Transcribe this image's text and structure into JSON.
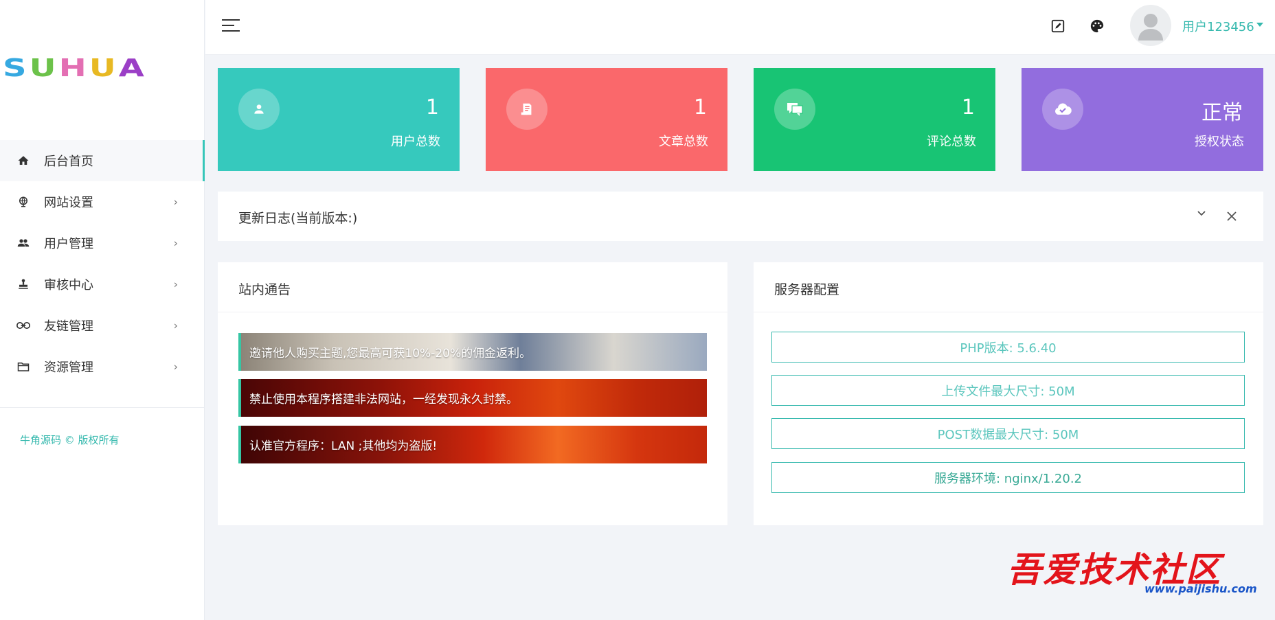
{
  "logo": {
    "letters": [
      {
        "ch": "S",
        "color": "#36a9e1"
      },
      {
        "ch": "U",
        "color": "#6cc24a"
      },
      {
        "ch": "H",
        "color": "#e36fb3"
      },
      {
        "ch": "U",
        "color": "#e8b923"
      },
      {
        "ch": "A",
        "color": "#9b3fc6"
      }
    ]
  },
  "sidebar": {
    "items": [
      {
        "label": "后台首页",
        "icon": "home-icon",
        "active": true
      },
      {
        "label": "网站设置",
        "icon": "globe-icon"
      },
      {
        "label": "用户管理",
        "icon": "users-icon"
      },
      {
        "label": "审核中心",
        "icon": "stamp-icon"
      },
      {
        "label": "友链管理",
        "icon": "link-icon"
      },
      {
        "label": "资源管理",
        "icon": "folder-icon"
      }
    ],
    "arrow": "›",
    "copyright": "牛角源码 © 版权所有"
  },
  "topbar": {
    "user_name": "用户123456"
  },
  "stats": [
    {
      "value": "1",
      "label": "用户总数",
      "color": "#36c9bd",
      "icon": "user-icon"
    },
    {
      "value": "1",
      "label": "文章总数",
      "color": "#fa686b",
      "icon": "article-icon"
    },
    {
      "value": "1",
      "label": "评论总数",
      "color": "#18c474",
      "icon": "comment-icon"
    },
    {
      "value": "正常",
      "label": "授权状态",
      "color": "#926dde",
      "icon": "cloud-check-icon"
    }
  ],
  "changelog": {
    "title": "更新日志(当前版本:)"
  },
  "notices": {
    "title": "站内通告",
    "items": [
      "邀请他人购买主题,您最高可获10%-20%的佣金返利。",
      "禁止使用本程序搭建非法网站，一经发现永久封禁。",
      "认准官方程序：LAN ;其他均为盗版!"
    ]
  },
  "server": {
    "title": "服务器配置",
    "items": [
      "PHP版本: 5.6.40",
      "上传文件最大尺寸: 50M",
      "POST数据最大尺寸: 50M",
      "服务器环境: nginx/1.20.2"
    ]
  },
  "watermark": {
    "text": "吾爱技术社区",
    "url": "www.paijishu.com"
  }
}
